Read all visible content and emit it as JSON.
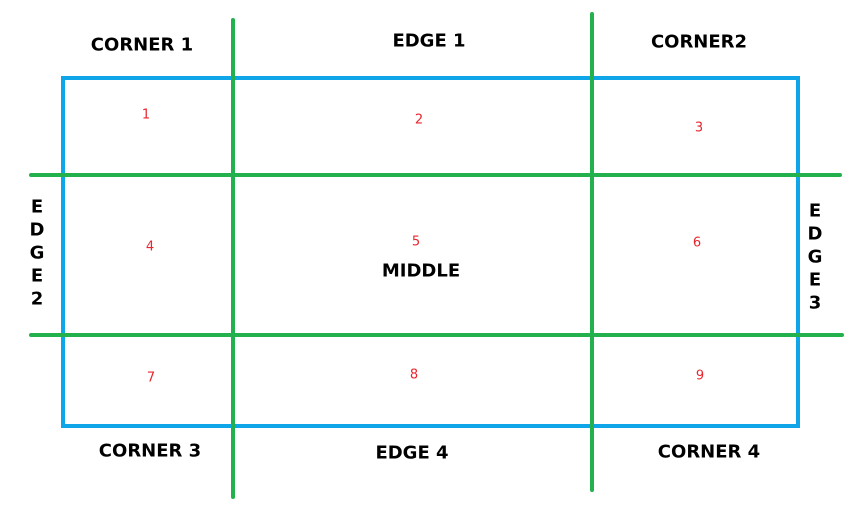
{
  "colors": {
    "border": "#0ea5e9",
    "grid": "#22b14c",
    "number": "#e8262e",
    "label": "#000000"
  },
  "labels": {
    "corner1": "CORNER 1",
    "edge1": "EDGE 1",
    "corner2": "CORNER2",
    "edge2": "EDGE2",
    "middle": "MIDDLE",
    "edge3": "EDGE3",
    "corner3": "CORNER 3",
    "edge4": "EDGE 4",
    "corner4": "CORNER 4"
  },
  "cells": [
    "1",
    "2",
    "3",
    "4",
    "5",
    "6",
    "7",
    "8",
    "9"
  ]
}
